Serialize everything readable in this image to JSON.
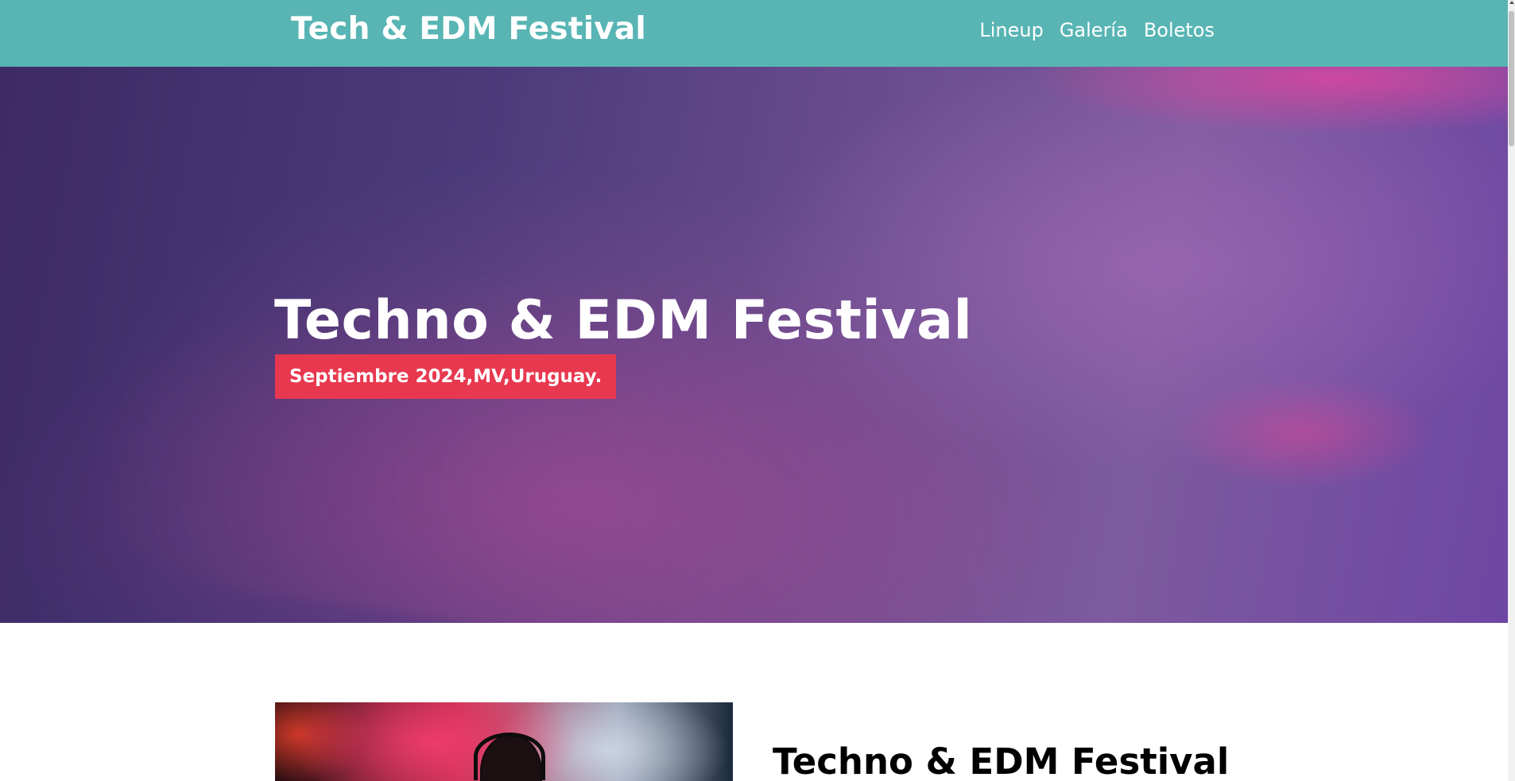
{
  "header": {
    "brand": "Tech & EDM Festival",
    "nav": [
      {
        "label": "Lineup"
      },
      {
        "label": "Galería"
      },
      {
        "label": "Boletos"
      }
    ]
  },
  "hero": {
    "title": "Techno & EDM Festival",
    "badge": "Septiembre 2024,MV,Uruguay."
  },
  "section": {
    "title": "Techno & EDM Festival"
  },
  "colors": {
    "header_bg": "#58b5b4",
    "badge_bg": "#e8384f",
    "hero_tint": "#4a3a7a"
  }
}
